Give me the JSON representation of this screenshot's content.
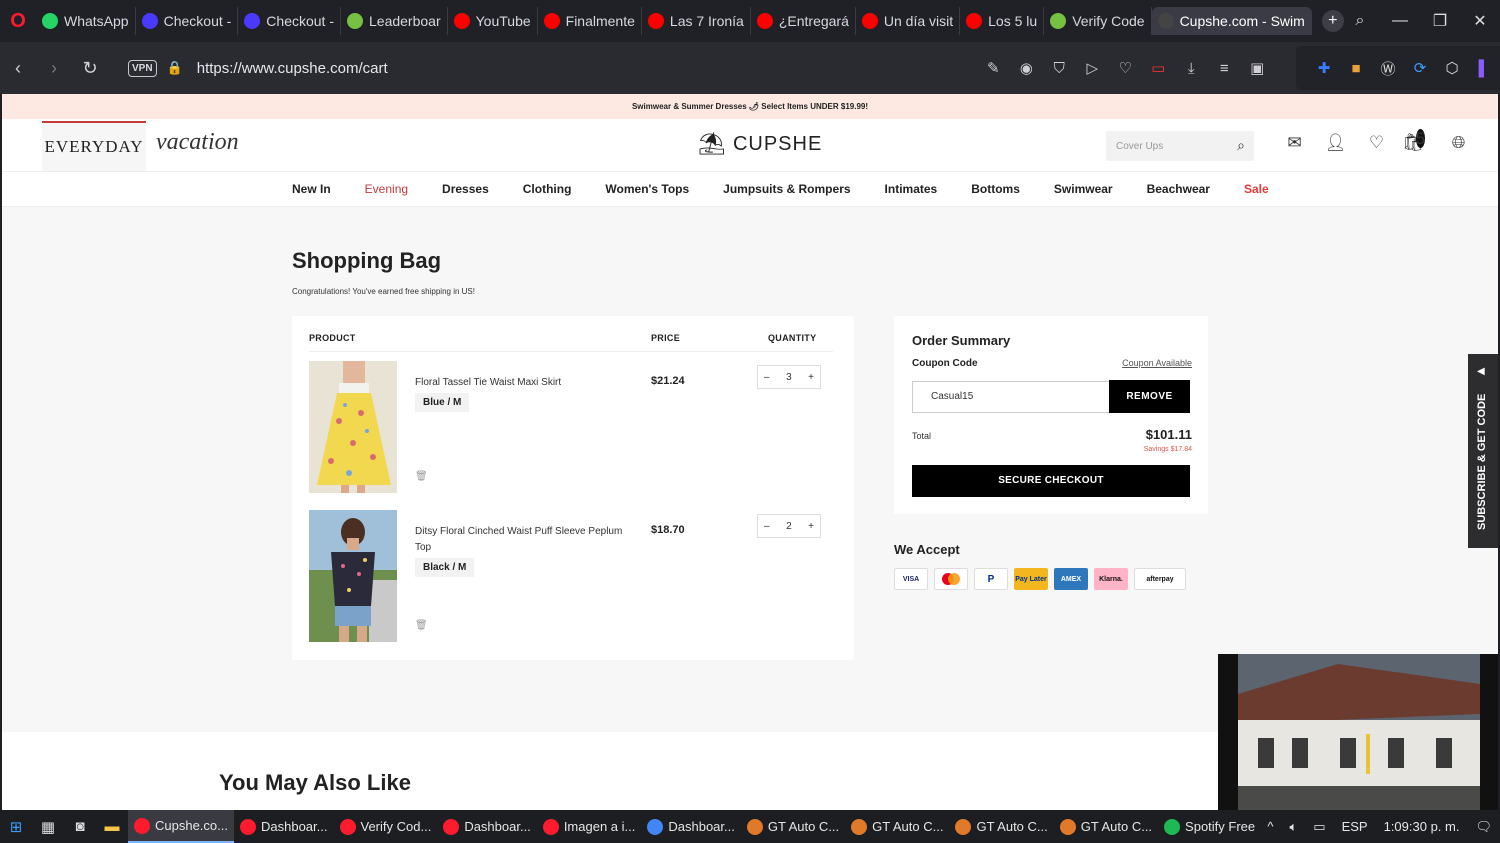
{
  "browser": {
    "tabs": [
      {
        "label": "WhatsApp",
        "color": "#25d366"
      },
      {
        "label": "Checkout -",
        "color": "#4a3aff"
      },
      {
        "label": "Checkout -",
        "color": "#4a3aff"
      },
      {
        "label": "Leaderboar",
        "color": "#76c043"
      },
      {
        "label": "YouTube",
        "color": "#ff0000"
      },
      {
        "label": "Finalmente",
        "color": "#ff0000"
      },
      {
        "label": "Las 7 Ironía",
        "color": "#ff0000"
      },
      {
        "label": "¿Entregará",
        "color": "#ff0000"
      },
      {
        "label": "Un día visit",
        "color": "#ff0000"
      },
      {
        "label": "Los 5 lu",
        "color": "#ff0000"
      },
      {
        "label": "Verify Code",
        "color": "#76c043"
      },
      {
        "label": "Cupshe.com - Swim",
        "color": "#444444"
      }
    ],
    "vpn_label": "VPN",
    "url": "https://www.cupshe.com/cart"
  },
  "promo_text": "Swimwear & Summer Dresses 🌶 Select Items UNDER $19.99!",
  "header": {
    "brand_everyday": "EVERYDAY",
    "brand_vacation": "vacation",
    "logo": "CUPSHE",
    "search_placeholder": "Cover Ups",
    "cart_count": "5"
  },
  "menu": [
    "New In",
    "Evening",
    "Dresses",
    "Clothing",
    "Women's Tops",
    "Jumpsuits & Rompers",
    "Intimates",
    "Bottoms",
    "Swimwear",
    "Beachwear",
    "Sale"
  ],
  "cart": {
    "title": "Shopping Bag",
    "congrats": "Congratulations! You've earned free shipping in US!",
    "headers": {
      "product": "PRODUCT",
      "price": "PRICE",
      "quantity": "QUANTITY"
    },
    "items": [
      {
        "name": "Floral Tassel Tie Waist Maxi Skirt",
        "variant": "Blue / M",
        "price": "$21.24",
        "qty": "3"
      },
      {
        "name": "Ditsy Floral Cinched Waist Puff Sleeve Peplum Top",
        "variant": "Black / M",
        "price": "$18.70",
        "qty": "2"
      }
    ]
  },
  "summary": {
    "title": "Order Summary",
    "coupon_label": "Coupon Code",
    "coupon_link": "Coupon Available",
    "coupon_value": "Casual15",
    "remove_label": "REMOVE",
    "total_label": "Total",
    "total_value": "$101.11",
    "savings": "Savings $17.84",
    "checkout_label": "SECURE CHECKOUT"
  },
  "we_accept": {
    "title": "We Accept",
    "methods": [
      "VISA",
      "Mastercard",
      "PayPal",
      "Pay Later",
      "AMEX",
      "Klarna.",
      "afterpay"
    ]
  },
  "subscribe_label": "SUBSCRIBE & GET CODE",
  "you_may_also_like": "You May Also Like",
  "taskbar": {
    "apps": [
      {
        "label": "Cupshe.co...",
        "color": "#ff1b2d"
      },
      {
        "label": "Dashboar...",
        "color": "#ff1b2d"
      },
      {
        "label": "Verify Cod...",
        "color": "#ff1b2d"
      },
      {
        "label": "Dashboar...",
        "color": "#ff1b2d"
      },
      {
        "label": "Imagen a i...",
        "color": "#ff1b2d"
      },
      {
        "label": "Dashboar...",
        "color": "#4285f4"
      },
      {
        "label": "GT Auto C...",
        "color": "#e07a2a"
      },
      {
        "label": "GT Auto C...",
        "color": "#e07a2a"
      },
      {
        "label": "GT Auto C...",
        "color": "#e07a2a"
      },
      {
        "label": "GT Auto C...",
        "color": "#e07a2a"
      },
      {
        "label": "Spotify Free",
        "color": "#1db954"
      }
    ],
    "language": "ESP",
    "clock": "1:09:30 p. m."
  }
}
